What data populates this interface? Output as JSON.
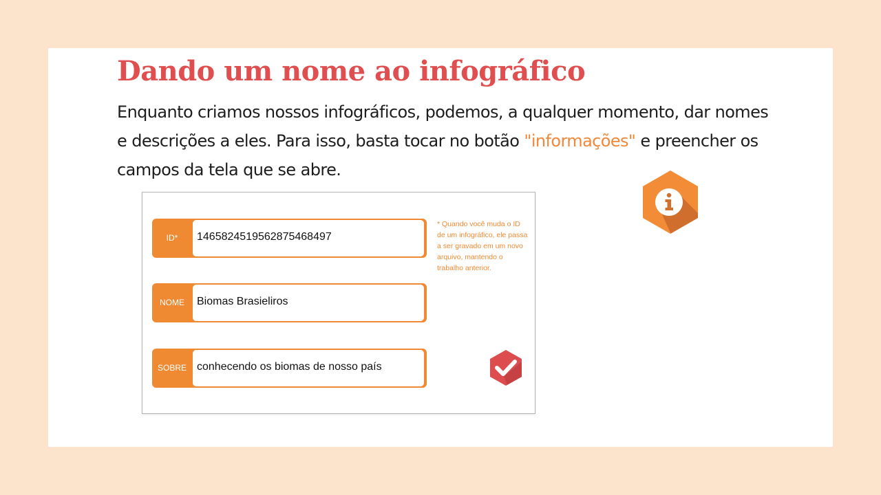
{
  "slide": {
    "title": "Dando um nome ao infográfico",
    "intro_part1": "Enquanto criamos nossos infográficos, podemos, a qualquer momento, dar nomes e descrições a eles. Para isso, basta tocar no botão ",
    "intro_highlight": "\"informações\"",
    "intro_part2": " e preencher os campos da tela que se abre.",
    "info_icon": "info-hexagon-icon"
  },
  "form": {
    "fields": [
      {
        "label": "ID*",
        "value": "1465824519562875468497"
      },
      {
        "label": "NOME",
        "value": "Biomas Brasieliros"
      },
      {
        "label": "SOBRE",
        "value": "conhecendo os biomas de nosso país"
      }
    ],
    "note": "* Quando você muda o ID de um infográfico, ele passa a ser gravado em um novo arquivo, mantendo o trabalho anterior.",
    "confirm_icon": "check-hexagon-icon"
  },
  "colors": {
    "background": "#fbe3cc",
    "title": "#e04f50",
    "accent": "#ef8a33",
    "confirm": "#dd4c4f"
  }
}
